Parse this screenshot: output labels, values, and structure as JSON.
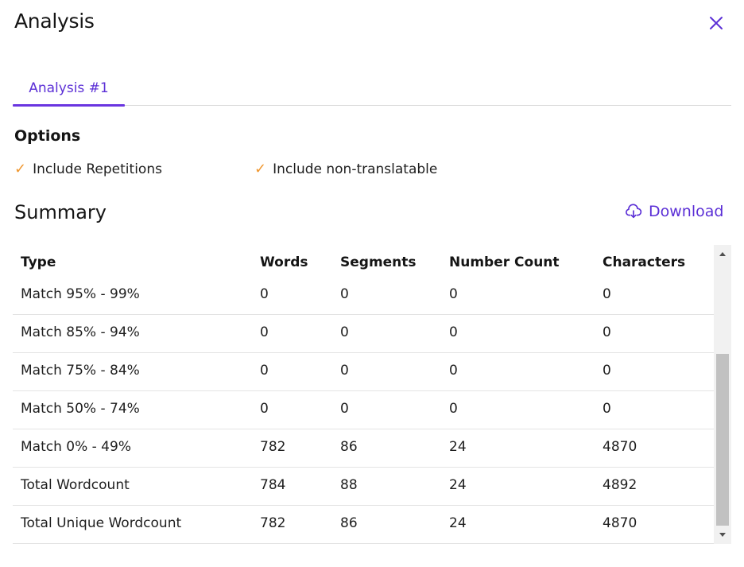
{
  "dialog": {
    "title": "Analysis"
  },
  "tabs": [
    {
      "label": "Analysis #1"
    }
  ],
  "options": {
    "heading": "Options",
    "items": [
      {
        "label": "Include Repetitions",
        "checked": true
      },
      {
        "label": "Include non-translatable",
        "checked": true
      }
    ]
  },
  "summary": {
    "heading": "Summary",
    "download_label": "Download",
    "columns": [
      "Type",
      "Words",
      "Segments",
      "Number Count",
      "Characters"
    ],
    "rows": [
      [
        "Match 95% - 99%",
        "0",
        "0",
        "0",
        "0"
      ],
      [
        "Match 85% - 94%",
        "0",
        "0",
        "0",
        "0"
      ],
      [
        "Match 75% - 84%",
        "0",
        "0",
        "0",
        "0"
      ],
      [
        "Match 50% - 74%",
        "0",
        "0",
        "0",
        "0"
      ],
      [
        "Match 0% - 49%",
        "782",
        "86",
        "24",
        "4870"
      ],
      [
        "Total Wordcount",
        "784",
        "88",
        "24",
        "4892"
      ],
      [
        "Total Unique Wordcount",
        "782",
        "86",
        "24",
        "4870"
      ]
    ]
  },
  "colors": {
    "accent": "#5b2fd6",
    "check": "#f0972f"
  },
  "icons": {
    "close": "close-icon",
    "download": "cloud-download-icon",
    "check": "check-icon"
  }
}
